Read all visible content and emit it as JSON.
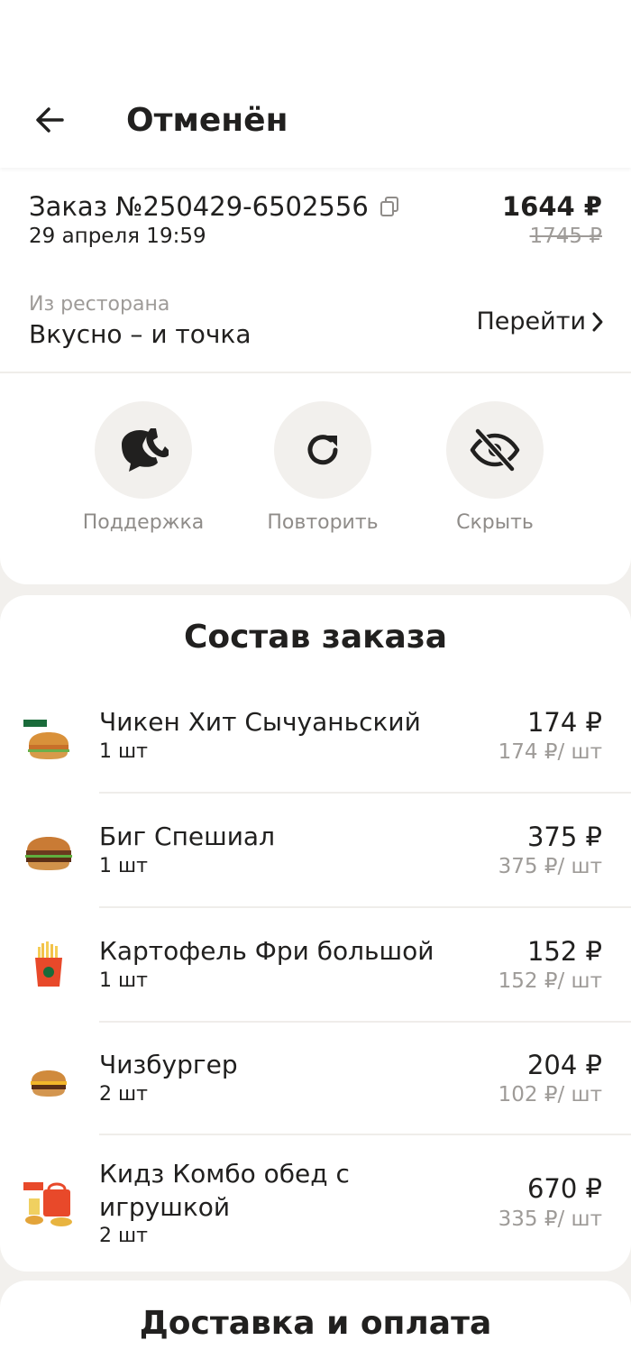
{
  "header": {
    "title": "Отменён",
    "back_icon": "arrow-left-icon"
  },
  "order": {
    "number": "Заказ №250429-6502556",
    "date": "29 апреля 19:59",
    "total": "1644 ₽",
    "old_total": "1745 ₽"
  },
  "restaurant": {
    "caption": "Из ресторана",
    "name": "Вкусно – и точка",
    "goto_label": "Перейти"
  },
  "actions": [
    {
      "label": "Поддержка",
      "icon": "support-chat-icon"
    },
    {
      "label": "Повторить",
      "icon": "repeat-icon"
    },
    {
      "label": "Скрыть",
      "icon": "hide-eye-icon"
    }
  ],
  "items_section": {
    "title": "Состав заказа"
  },
  "items": [
    {
      "name": "Чикен Хит Сычуаньский",
      "qty": "1 шт",
      "price": "174 ₽",
      "unit_price": "174 ₽/ шт"
    },
    {
      "name": "Биг Спешиал",
      "qty": "1 шт",
      "price": "375 ₽",
      "unit_price": "375 ₽/ шт"
    },
    {
      "name": "Картофель Фри большой",
      "qty": "1 шт",
      "price": "152 ₽",
      "unit_price": "152 ₽/ шт"
    },
    {
      "name": "Чизбургер",
      "qty": "2 шт",
      "price": "204 ₽",
      "unit_price": "102 ₽/ шт"
    },
    {
      "name": "Кидз Комбо обед с игрушкой",
      "qty": "2 шт",
      "price": "670 ₽",
      "unit_price": "335 ₽/ шт"
    }
  ],
  "delivery_section": {
    "title": "Доставка и оплата"
  },
  "colors": {
    "background": "#f2f0ed",
    "text": "#21201f",
    "muted": "#9e9b98"
  }
}
